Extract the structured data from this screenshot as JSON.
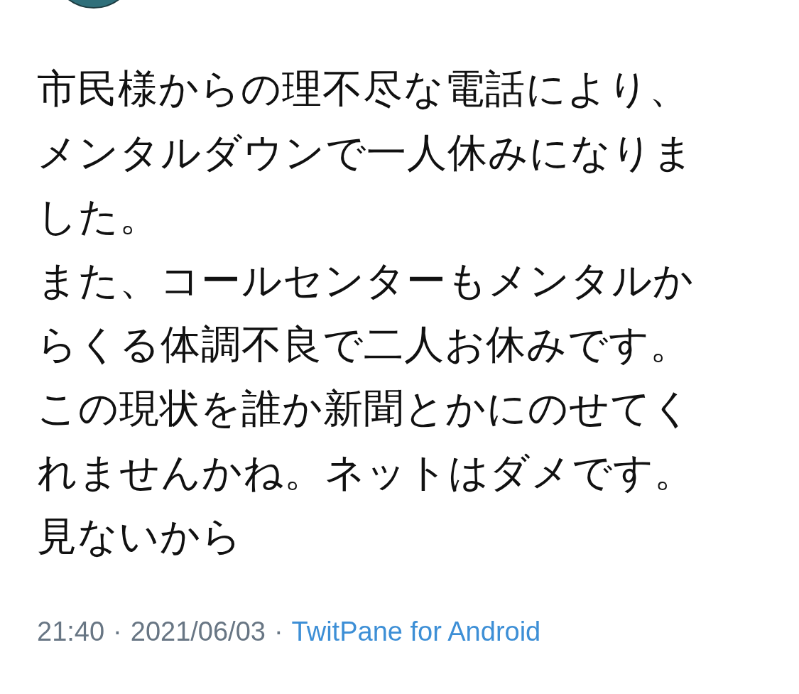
{
  "tweet": {
    "lines": [
      "市民様からの理不尽な電話により、",
      "メンタルダウンで一人休みになりま",
      "した。",
      "また、コールセンターもメンタルか",
      "らくる体調不良で二人お休みです。",
      "この現状を誰か新聞とかにのせてく",
      "れませんかね。ネットはダメです。",
      "見ないから"
    ],
    "meta": [
      {
        "kind": "time",
        "text": "21:40"
      },
      {
        "kind": "separator",
        "text": "·"
      },
      {
        "kind": "date",
        "text": "2021/06/03"
      },
      {
        "kind": "separator",
        "text": "·"
      },
      {
        "kind": "source",
        "text": "TwitPane for Android"
      }
    ]
  }
}
